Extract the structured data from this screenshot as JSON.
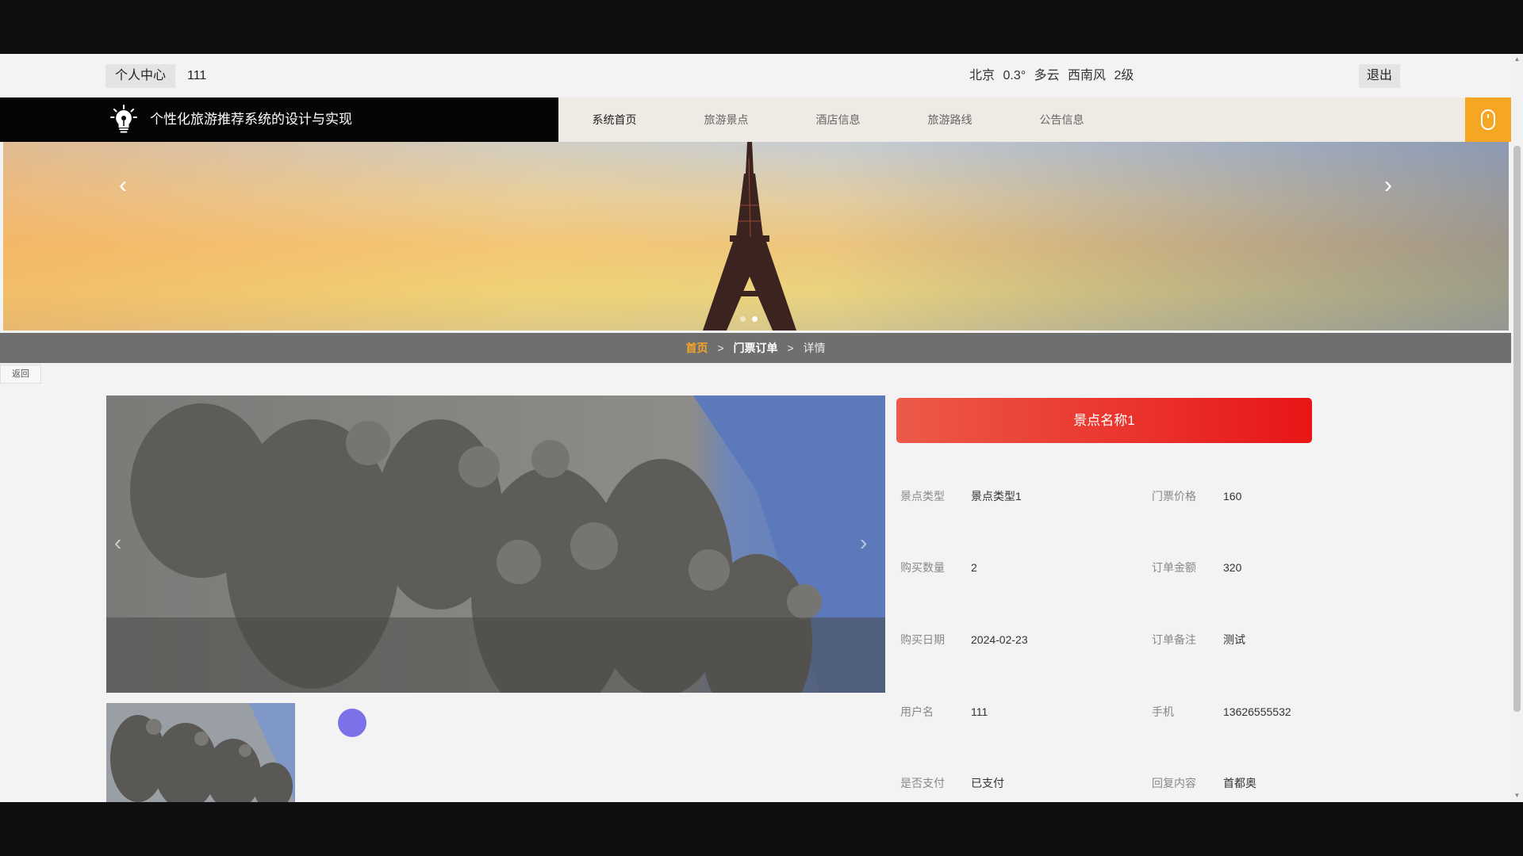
{
  "topbar": {
    "center_label": "个人中心",
    "username": "111",
    "weather": {
      "city": "北京",
      "temp": "0.3°",
      "condition": "多云",
      "wind_dir": "西南风",
      "wind_level": "2级"
    },
    "logout_label": "退出"
  },
  "brand": {
    "title": "个性化旅游推荐系统的设计与实现"
  },
  "nav": {
    "items": [
      "系统首页",
      "旅游景点",
      "酒店信息",
      "旅游路线",
      "公告信息"
    ]
  },
  "breadcrumb": {
    "home": "首页",
    "sep": ">",
    "section": "门票订单",
    "current": "详情"
  },
  "back_label": "返回",
  "detail": {
    "title": "景点名称1",
    "fields": [
      {
        "label": "景点类型",
        "value": "景点类型1",
        "label2": "门票价格",
        "value2": "160"
      },
      {
        "label": "购买数量",
        "value": "2",
        "label2": "订单金额",
        "value2": "320"
      },
      {
        "label": "购买日期",
        "value": "2024-02-23",
        "label2": "订单备注",
        "value2": "测试"
      },
      {
        "label": "用户名",
        "value": "111",
        "label2": "手机",
        "value2": "13626555532"
      },
      {
        "label": "是否支付",
        "value": "已支付",
        "label2": "回复内容",
        "value2": "首都奥"
      }
    ]
  },
  "colors": {
    "accent": "#f5a623",
    "title_red": "#e81616",
    "brand_bg": "#050505"
  }
}
